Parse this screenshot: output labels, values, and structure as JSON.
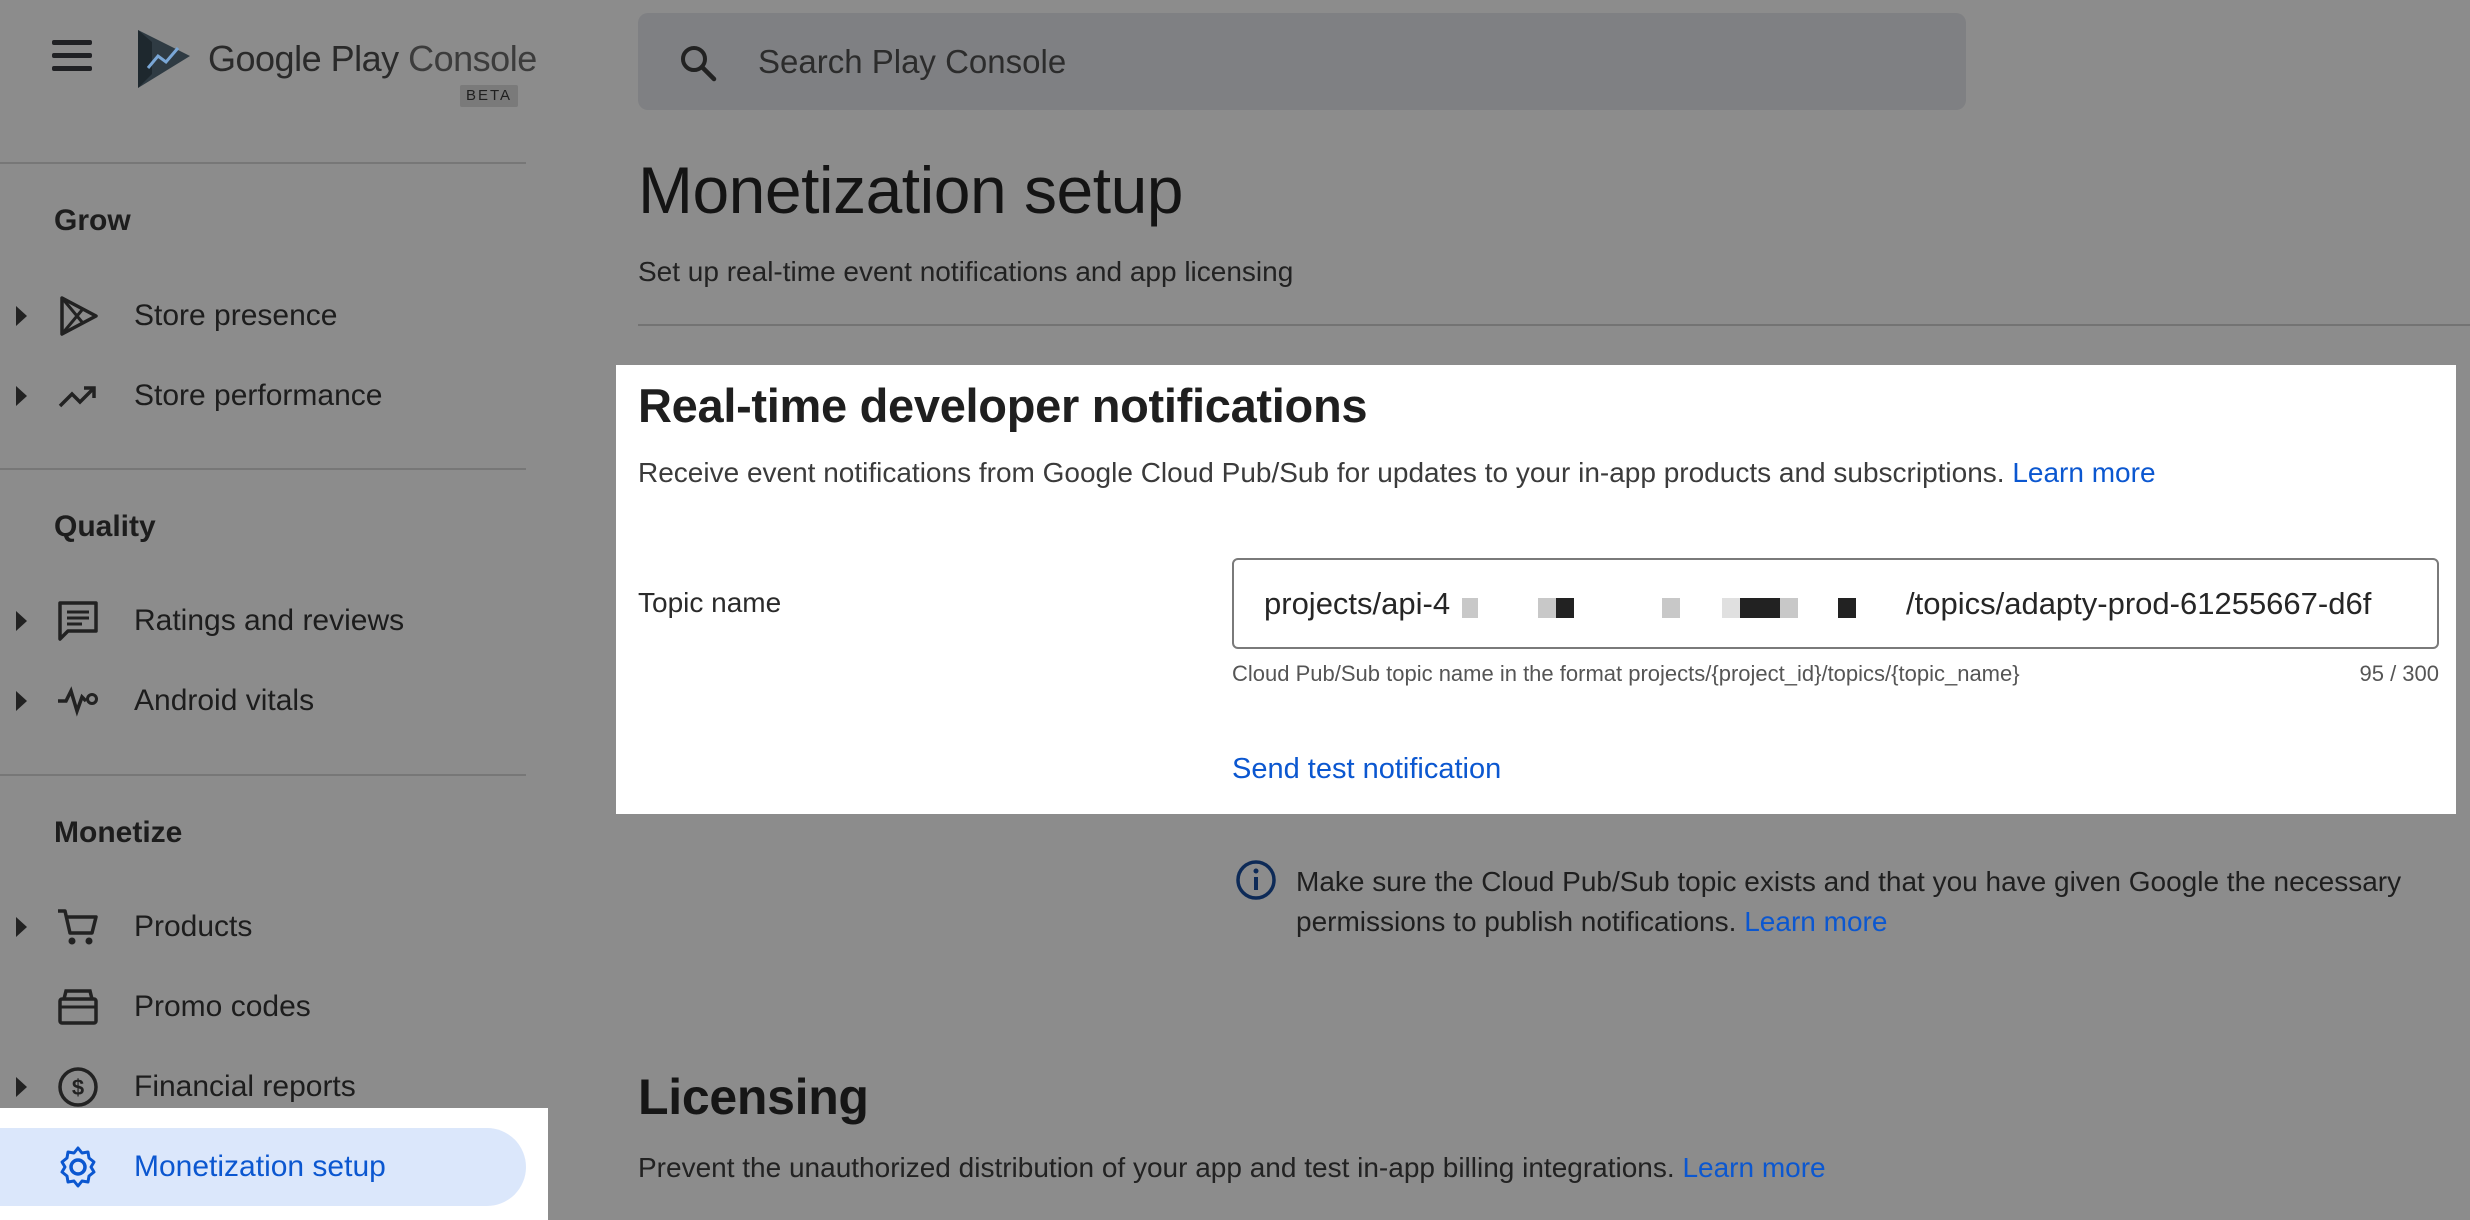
{
  "header": {
    "app_name": "Google Play Console",
    "app_name_part1": "Google Play",
    "app_name_part2": " Console",
    "beta_badge": "BETA",
    "search_placeholder": "Search Play Console"
  },
  "sidebar": {
    "sections": [
      {
        "title": "Grow"
      },
      {
        "title": "Quality"
      },
      {
        "title": "Monetize"
      }
    ],
    "items": [
      {
        "label": "Store presence",
        "icon": "play-outline-icon",
        "expandable": true
      },
      {
        "label": "Store performance",
        "icon": "trending-up-icon",
        "expandable": true
      },
      {
        "label": "Ratings and reviews",
        "icon": "review-comment-icon",
        "expandable": true
      },
      {
        "label": "Android vitals",
        "icon": "pulse-icon",
        "expandable": true
      },
      {
        "label": "Products",
        "icon": "shopping-cart-icon",
        "expandable": true
      },
      {
        "label": "Promo codes",
        "icon": "promo-code-icon",
        "expandable": false
      },
      {
        "label": "Financial reports",
        "icon": "dollar-circle-icon",
        "expandable": true
      },
      {
        "label": "Monetization setup",
        "icon": "gear-icon",
        "expandable": false,
        "active": true
      }
    ]
  },
  "main": {
    "title": "Monetization setup",
    "subtitle": "Set up real-time event notifications and app licensing",
    "rtdn": {
      "title": "Real-time developer notifications",
      "description": "Receive event notifications from Google Cloud Pub/Sub for updates to your in-app products and subscriptions.",
      "learn_more": "Learn more",
      "topic_label": "Topic name",
      "topic_value_start": "projects/api-4",
      "topic_value_end": "/topics/adapty-prod-61255667-d6f",
      "helper": "Cloud Pub/Sub topic name in the format projects/{project_id}/topics/{topic_name}",
      "counter": "95 / 300",
      "send_test": "Send test notification"
    },
    "info": {
      "text": "Make sure the Cloud Pub/Sub topic exists and that you have given Google the necessary permissions to publish notifications.",
      "learn_more": "Learn more"
    },
    "licensing": {
      "title": "Licensing",
      "description": "Prevent the unauthorized distribution of your app and test in-app billing integrations.",
      "learn_more": "Learn more"
    }
  },
  "colors": {
    "accent": "#0b57d0",
    "active_bg": "#dbe7fb",
    "overlay": "#8c8c8c"
  }
}
